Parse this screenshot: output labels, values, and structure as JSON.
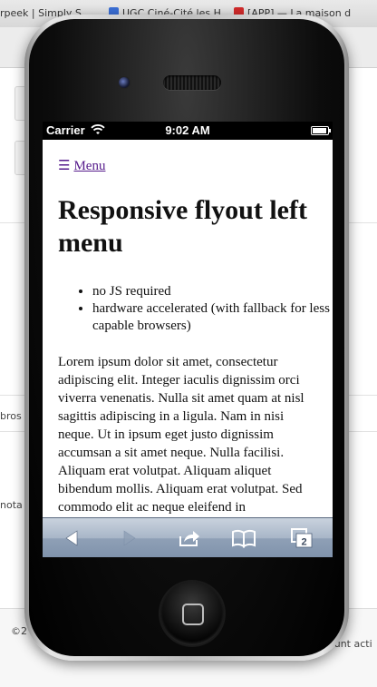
{
  "desktop_browser": {
    "tabs": [
      {
        "label": "rpeek | Simply S",
        "icon": "page-favicon"
      },
      {
        "label": "UGC Ciné-Cité les H",
        "icon": "google-favicon",
        "color": "#3b6fd6"
      },
      {
        "label": "[APP] — La maison d",
        "icon": "adobe-favicon",
        "color": "#d22b2b"
      }
    ],
    "page_fragments": {
      "left_text_1": "bros",
      "left_text_2": "nota",
      "footer_left": "©2",
      "footer_right": "ount acti"
    }
  },
  "device": {
    "model": "iPhone",
    "status_bar": {
      "carrier": "Carrier",
      "time": "9:02 AM",
      "wifi_icon": "wifi-icon",
      "battery_icon": "battery-icon"
    }
  },
  "page": {
    "menu_icon": "☰",
    "menu_label": "Menu",
    "title": "Responsive flyout left menu",
    "features": [
      "no JS required",
      "hardware accelerated (with fallback for less capable browsers)"
    ],
    "body": "Lorem ipsum dolor sit amet, consectetur adipiscing elit. Integer iaculis dignissim orci viverra venenatis. Nulla sit amet quam at nisl sagittis adipiscing in a ligula. Nam in nisi neque. Ut in ipsum eget justo dignissim accumsan a sit amet neque. Nulla facilisi. Aliquam erat volutpat. Aliquam aliquet bibendum mollis. Aliquam erat volutpat. Sed commodo elit ac neque eleifend in"
  },
  "safari_toolbar": {
    "back_icon": "back-arrow-icon",
    "forward_icon": "forward-arrow-icon",
    "share_icon": "share-icon",
    "bookmarks_icon": "bookmarks-icon",
    "tabs_icon": "tabs-icon",
    "tab_count": "2",
    "colors": {
      "bar_top": "#c9d2de",
      "bar_bottom": "#7f92ab",
      "icon": "#ffffff"
    }
  }
}
